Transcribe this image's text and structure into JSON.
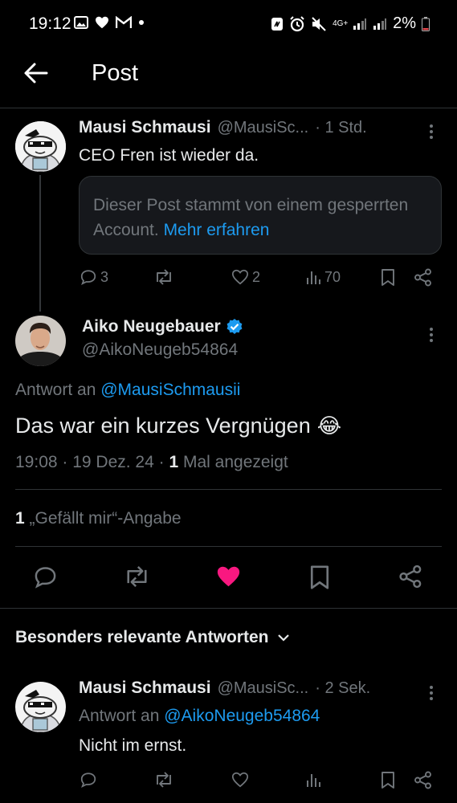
{
  "status_bar": {
    "time": "19:12",
    "network": "4G+",
    "battery": "2%"
  },
  "header": {
    "title": "Post"
  },
  "parent_post": {
    "name": "Mausi Schmausi",
    "handle": "@MausiSc...",
    "time": "· 1 Std.",
    "text": "CEO Fren ist wieder da.",
    "notice_text": "Dieser Post stammt von einem gesperrten Account.",
    "notice_link": "Mehr erfahren",
    "replies": "3",
    "likes": "2",
    "views": "70"
  },
  "main_post": {
    "name": "Aiko Neugebauer",
    "handle": "@AikoNeugeb54864",
    "reply_to_prefix": "Antwort an",
    "reply_to_handle": "@MausiSchmausii",
    "text": "Das war ein kurzes Vergnügen",
    "emoji": "😂",
    "timestamp": "19:08 · 19 Dez. 24 ·",
    "view_count": "1",
    "views_label": "Mal angezeigt",
    "like_count": "1",
    "like_label": "„Gefällt mir“-Angabe"
  },
  "replies_section": {
    "label": "Besonders relevante Antworten"
  },
  "reply_post": {
    "name": "Mausi Schmausi",
    "handle": "@MausiSc...",
    "time": "· 2 Sek.",
    "reply_to_prefix": "Antwort an",
    "reply_to_handle": "@AikoNeugeb54864",
    "text": "Nicht im ernst."
  },
  "colors": {
    "background": "#000000",
    "text": "#e7e9ea",
    "muted": "#71767b",
    "link": "#1d9bf0",
    "like": "#f91880",
    "verified": "#1d9bf0"
  }
}
